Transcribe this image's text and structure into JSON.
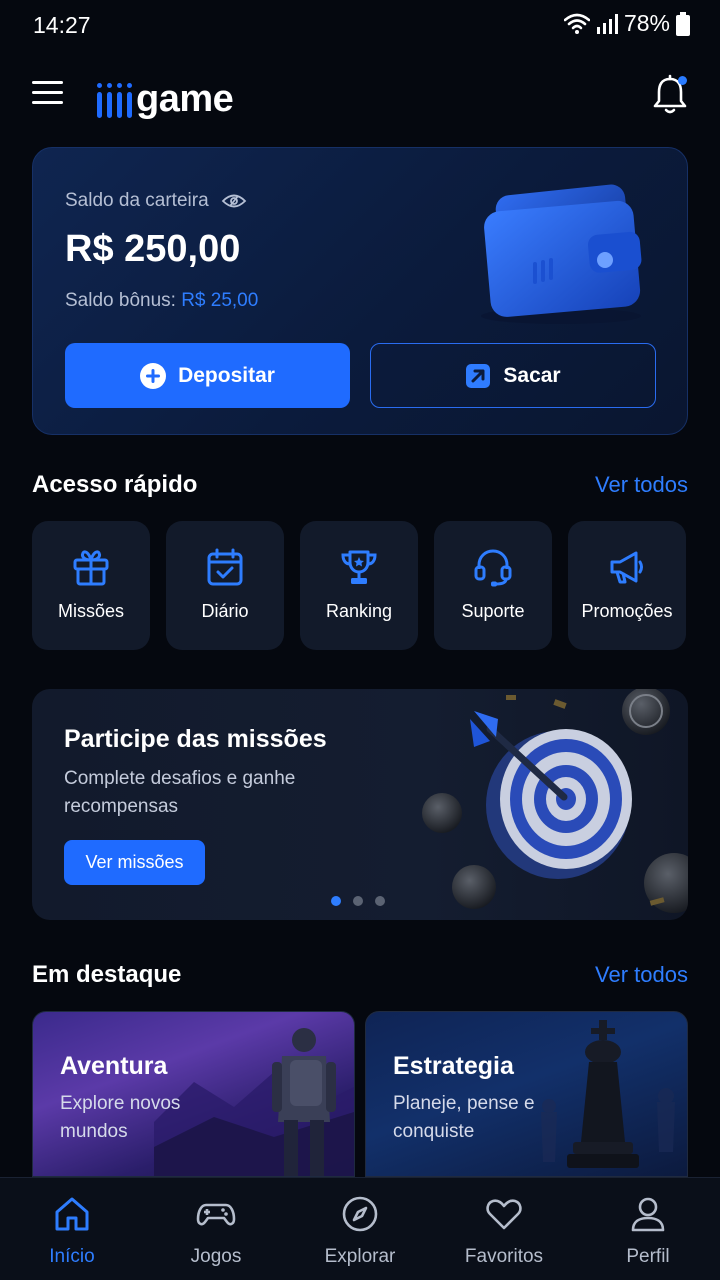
{
  "status_bar": {
    "time": "14:27",
    "battery": "78%"
  },
  "header": {
    "logo_text": "game",
    "notification_dot": true
  },
  "wallet": {
    "label": "Saldo da carteira",
    "amount": "R$ 250,00",
    "bonus_label": "Saldo bônus:",
    "bonus_value": "R$ 25,00",
    "deposit_label": "Depositar",
    "withdraw_label": "Sacar"
  },
  "quick_access": {
    "title": "Acesso rápido",
    "see_all": "Ver todos",
    "items": [
      {
        "label": "Missões",
        "icon": "gift-icon"
      },
      {
        "label": "Diário",
        "icon": "calendar-check-icon"
      },
      {
        "label": "Ranking",
        "icon": "trophy-icon"
      },
      {
        "label": "Suporte",
        "icon": "headset-icon"
      },
      {
        "label": "Promoções",
        "icon": "megaphone-icon"
      }
    ]
  },
  "missions_banner": {
    "title": "Participe das missões",
    "description": "Complete desafios e ganhe recompensas",
    "button": "Ver missões",
    "carousel_index": 1,
    "carousel_count": 3
  },
  "featured": {
    "title": "Em destaque",
    "see_all": "Ver todos",
    "items": [
      {
        "title": "Aventura",
        "description": "Explore novos mundos"
      },
      {
        "title": "Estrategia",
        "description": "Planeje, pense e conquiste"
      }
    ]
  },
  "bottom_nav": {
    "items": [
      {
        "label": "Início",
        "icon": "home-icon",
        "active": true
      },
      {
        "label": "Jogos",
        "icon": "gamepad-icon",
        "active": false
      },
      {
        "label": "Explorar",
        "icon": "compass-icon",
        "active": false
      },
      {
        "label": "Favoritos",
        "icon": "heart-icon",
        "active": false
      },
      {
        "label": "Perfil",
        "icon": "user-icon",
        "active": false
      }
    ]
  },
  "colors": {
    "accent": "#1f6bff",
    "accent_text": "#2e7dff",
    "background": "#05080f",
    "card": "#121a2a"
  }
}
